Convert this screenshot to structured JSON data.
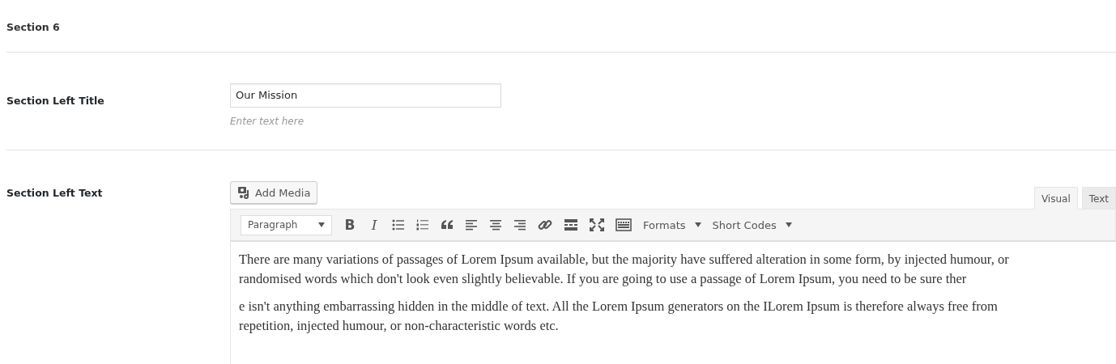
{
  "section_heading": "Section 6",
  "title_field": {
    "label": "Section Left Title",
    "value": "Our Mission",
    "hint": "Enter text here"
  },
  "text_field": {
    "label": "Section Left Text",
    "add_media": "Add Media",
    "tabs": [
      {
        "label": "Visual",
        "selected": true
      },
      {
        "label": "Text",
        "selected": false
      }
    ],
    "toolbar": [
      {
        "kind": "select",
        "label": "Paragraph"
      },
      {
        "kind": "bold",
        "label": "B"
      },
      {
        "kind": "italic",
        "label": "I"
      },
      {
        "kind": "bullets"
      },
      {
        "kind": "numbers"
      },
      {
        "kind": "quote"
      },
      {
        "kind": "align-left"
      },
      {
        "kind": "align-center"
      },
      {
        "kind": "align-right"
      },
      {
        "kind": "link"
      },
      {
        "kind": "more"
      },
      {
        "kind": "fullscreen"
      },
      {
        "kind": "keyboard"
      },
      {
        "kind": "menu",
        "label": "Formats"
      },
      {
        "kind": "menu",
        "label": "Short Codes"
      }
    ],
    "paragraphs": [
      "There are many variations of passages of Lorem Ipsum available, but the majority have suffered alteration in some form, by injected humour, or randomised words which don't look even slightly believable. If you are going to use a passage of Lorem Ipsum, you need to be sure ther",
      "e isn't anything embarrassing hidden in the middle of text. All the Lorem Ipsum generators on the ILorem Ipsum is therefore always free from repetition, injected humour, or non-characteristic words etc."
    ]
  }
}
